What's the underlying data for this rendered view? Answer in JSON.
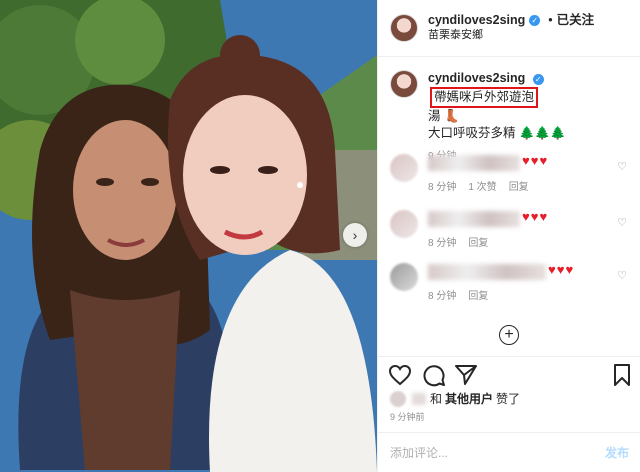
{
  "header": {
    "username": "cyndiloves2sing",
    "dot": "•",
    "follow_status": "已关注",
    "location": "苗栗泰安鄉"
  },
  "caption": {
    "username": "cyndiloves2sing",
    "text_before": " ",
    "highlighted_text": "帶媽咪戶外郊遊泡",
    "text_line2": "湯",
    "boot_emoji": "👢",
    "text_line3": "大口呼吸芬多精",
    "tree_emojis": "🌲🌲🌲",
    "time": "9 分钟"
  },
  "comments": [
    {
      "hearts": "♥♥♥",
      "time": "8 分钟",
      "likes": "1 次赞",
      "reply": "回复"
    },
    {
      "hearts": "♥♥♥",
      "time": "8 分钟",
      "likes": "",
      "reply": "回复"
    },
    {
      "hearts": "♥♥♥",
      "time": "8 分钟",
      "likes": "",
      "reply": "回复"
    }
  ],
  "likers": {
    "and": "和",
    "others": "其他用户",
    "liked": "赞了"
  },
  "post_time": "9 分钟前",
  "add_comment": {
    "placeholder": "添加评论...",
    "post_label": "发布"
  },
  "colors": {
    "verified": "#3897f0",
    "heart": "#e51e2a",
    "highlight_box": "#e0141b",
    "post_button": "#b3dbff"
  }
}
